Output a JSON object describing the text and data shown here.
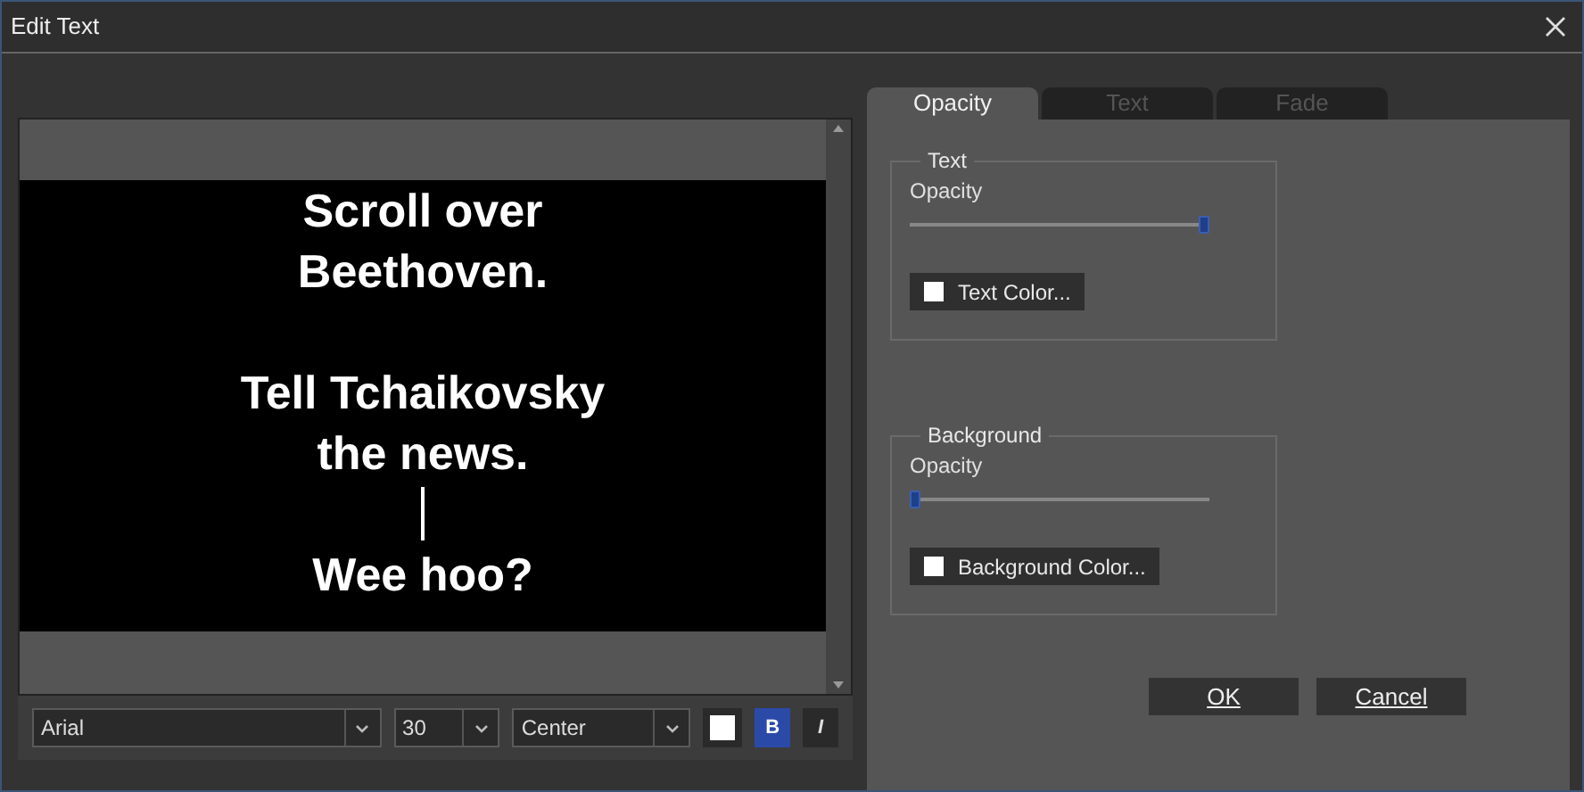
{
  "window": {
    "title": "Edit Text"
  },
  "editor": {
    "lines": [
      {
        "kind": "text",
        "text": "Scroll over"
      },
      {
        "kind": "text",
        "text": "Beethoven."
      },
      {
        "kind": "blank"
      },
      {
        "kind": "text",
        "text": "Tell Tchaikovsky"
      },
      {
        "kind": "text",
        "text": "the news."
      },
      {
        "kind": "caret"
      },
      {
        "kind": "text",
        "text": "Wee hoo?"
      }
    ]
  },
  "toolbar": {
    "font": "Arial",
    "size": "30",
    "alignment": "Center",
    "text_color": {
      "color": "#ffffff"
    },
    "bold": {
      "label": "B",
      "selected": true
    },
    "italic": {
      "label": "I",
      "selected": false
    }
  },
  "tabs": [
    {
      "label": "Opacity",
      "selected": true
    },
    {
      "label": "Text",
      "selected": false
    },
    {
      "label": "Fade",
      "selected": false
    }
  ],
  "groups": [
    {
      "title": "Text",
      "slider_label": "Opacity",
      "level": 1,
      "button": "Text Color...",
      "color": "#ffffff"
    },
    {
      "title": "Background",
      "slider_label": "Opacity",
      "level": 0,
      "button": "Background Color...",
      "color": "#ffffff"
    }
  ],
  "buttons": {
    "ok": "OK",
    "cancel": "Cancel"
  }
}
